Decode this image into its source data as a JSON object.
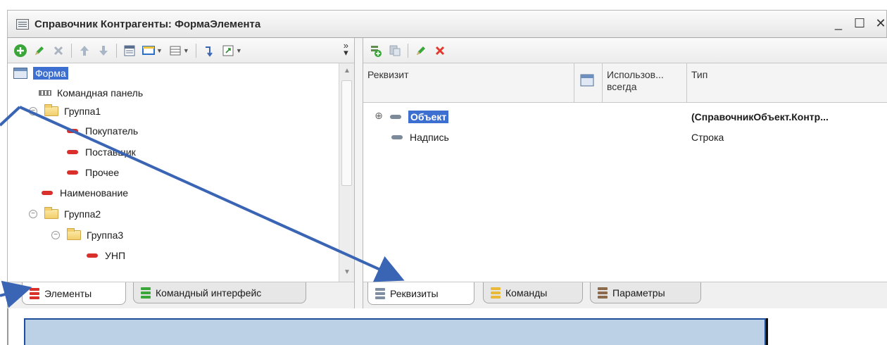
{
  "window": {
    "title": "Справочник Контрагенты: ФормаЭлемента",
    "minimize": "_",
    "maximize": "☐",
    "close": "✕"
  },
  "left_panel": {
    "toolbar": {
      "add_icon": "add-icon",
      "edit_icon": "pencil-icon",
      "delete_icon": "delete-icon",
      "more": "»"
    },
    "tree": [
      {
        "label": "Форма",
        "icon": "form-icon",
        "selected": true
      },
      {
        "label": "Командная панель",
        "icon": "command-panel-icon"
      },
      {
        "label": "Группа1",
        "icon": "folder-icon",
        "expander": "⊖"
      },
      {
        "label": "Покупатель",
        "icon": "field-icon"
      },
      {
        "label": "Поставщик",
        "icon": "field-icon"
      },
      {
        "label": "Прочее",
        "icon": "field-icon"
      },
      {
        "label": "Наименование",
        "icon": "field-icon"
      },
      {
        "label": "Группа2",
        "icon": "folder-icon",
        "expander": "⊖"
      },
      {
        "label": "Группа3",
        "icon": "folder-icon",
        "expander": "⊖"
      },
      {
        "label": "УНП",
        "icon": "field-icon"
      }
    ],
    "tabs": [
      {
        "label": "Элементы",
        "active": true
      },
      {
        "label": "Командный интерфейс",
        "active": false
      }
    ]
  },
  "right_panel": {
    "columns": {
      "attribute": "Реквизит",
      "use_always": "Использов... всегда",
      "type": "Тип"
    },
    "rows": [
      {
        "name": "Объект",
        "type": "(СправочникОбъект.Контр...",
        "expander": "⊕",
        "selected": true
      },
      {
        "name": "Надпись",
        "type": "Строка"
      }
    ],
    "tabs": [
      {
        "label": "Реквизиты",
        "active": true
      },
      {
        "label": "Команды",
        "active": false
      },
      {
        "label": "Параметры",
        "active": false
      }
    ]
  },
  "colors": {
    "selection": "#3d6fd1",
    "field_red": "#d9302c",
    "arrow": "#3a64b4",
    "bottom_box": "#bcd0e6"
  }
}
